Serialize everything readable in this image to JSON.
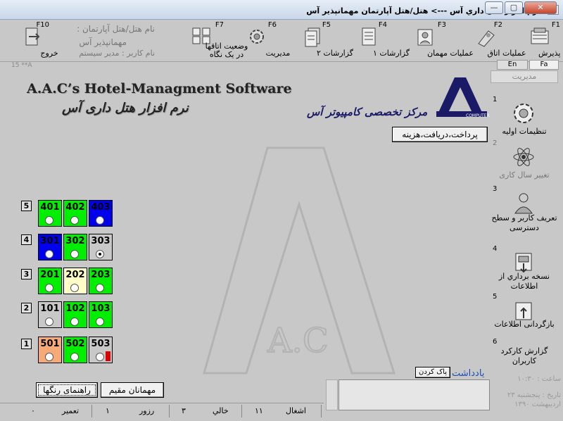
{
  "window": {
    "title": "نرم افزار هتل داري آس   --->  هتل/هتل آپارتمان مهمانپذير آس",
    "buttons": {
      "minimize": "—",
      "maximize": "▢",
      "close": "✕"
    }
  },
  "toolbar": [
    {
      "key": "F1",
      "label": "عملیات پذیرش",
      "icon": "reception-icon"
    },
    {
      "key": "F2",
      "label": "عملیات اتاق",
      "icon": "room-ops-icon"
    },
    {
      "key": "F3",
      "label": "عملیات مهمان",
      "icon": "guest-ops-icon"
    },
    {
      "key": "F4",
      "label": "گزارشات ۱",
      "icon": "report1-icon"
    },
    {
      "key": "F5",
      "label": "گزارشات ۲",
      "icon": "report2-icon"
    },
    {
      "key": "F6",
      "label": "مدیریت",
      "icon": "management-icon"
    },
    {
      "key": "F7",
      "label": "وضعیت اتاقها در یک نگاه",
      "icon": "rooms-glance-icon"
    },
    {
      "key": "F10",
      "label": "خروج",
      "icon": "exit-icon"
    }
  ],
  "hotel_info": {
    "name_label": "نام هتل/هتل آپارتمان :",
    "name_value": "مهمانپذیر آس",
    "user": "نام کاربر : مدیر سیستم"
  },
  "version": "15 **A",
  "lang": {
    "en": "En",
    "fa": "Fa"
  },
  "management_header": "مدیریت",
  "sidebar": [
    {
      "num": "1",
      "label": "تنظیمات اولیه",
      "icon": "settings-gear-icon"
    },
    {
      "num": "2",
      "label": "تغییر سال کاری",
      "icon": "atom-icon"
    },
    {
      "num": "3",
      "label": "تعریف کاربر و سطح دسترسی",
      "icon": "user-access-icon"
    },
    {
      "num": "4",
      "label": "نسخه برداري از اطلاعات",
      "icon": "backup-icon"
    },
    {
      "num": "5",
      "label": "بازگردانی اطلاعات",
      "icon": "restore-icon"
    },
    {
      "num": "6",
      "label": "گزارش کارکرد کاربران",
      "icon": "user-report-icon"
    }
  ],
  "brand": {
    "en": "A.A.C’s Hotel-Managment Software",
    "fa": "نرم افزار هتل داری آس",
    "center": "مرکز تخصصی کامپیوتر آس",
    "logo_text": "COMPUTER"
  },
  "payment_button": "پرداخت،دریافت،هزینه",
  "floors": [
    {
      "floor": "5",
      "rooms": [
        {
          "n": "401",
          "color": "#00ee00",
          "sel": false,
          "red": false
        },
        {
          "n": "402",
          "color": "#00ee00",
          "sel": false,
          "red": false
        },
        {
          "n": "403",
          "color": "#0000ee",
          "sel": false,
          "red": false
        }
      ]
    },
    {
      "floor": "4",
      "rooms": [
        {
          "n": "301",
          "color": "#0000ee",
          "sel": false,
          "red": false
        },
        {
          "n": "302",
          "color": "#00ee00",
          "sel": false,
          "red": false
        },
        {
          "n": "303",
          "color": "#c8c8c8",
          "sel": true,
          "red": false
        }
      ]
    },
    {
      "floor": "3",
      "rooms": [
        {
          "n": "201",
          "color": "#00ee00",
          "sel": false,
          "red": false
        },
        {
          "n": "202",
          "color": "#ffffc8",
          "sel": false,
          "red": false
        },
        {
          "n": "203",
          "color": "#00ee00",
          "sel": false,
          "red": false
        }
      ]
    },
    {
      "floor": "2",
      "rooms": [
        {
          "n": "101",
          "color": "#c8c8c8",
          "sel": false,
          "red": false
        },
        {
          "n": "102",
          "color": "#00ee00",
          "sel": false,
          "red": false
        },
        {
          "n": "103",
          "color": "#00ee00",
          "sel": false,
          "red": false
        }
      ]
    },
    {
      "floor": "1",
      "rooms": [
        {
          "n": "501",
          "color": "#f5aa78",
          "sel": false,
          "red": false
        },
        {
          "n": "502",
          "color": "#00ee00",
          "sel": false,
          "red": false
        },
        {
          "n": "503",
          "color": "#c8c8c8",
          "sel": false,
          "red": true
        }
      ]
    }
  ],
  "buttons": {
    "color_guide": "راهنمای رنگها",
    "resident_guests": "مهمانان مقیم"
  },
  "notes": {
    "label": "یادداشت",
    "clear": "پاک کردن"
  },
  "datetime": {
    "time": "ساعت : ۱۰:۳۰",
    "date": "تاریخ : پنجشنبه ۲۳ اردیبهشت ۱۳۹۰"
  },
  "status": [
    {
      "label": "اشغال",
      "value": "۱۱"
    },
    {
      "label": "خالي",
      "value": "۳"
    },
    {
      "label": "رزور",
      "value": "۱"
    },
    {
      "label": "تعمیر",
      "value": "۰"
    }
  ]
}
